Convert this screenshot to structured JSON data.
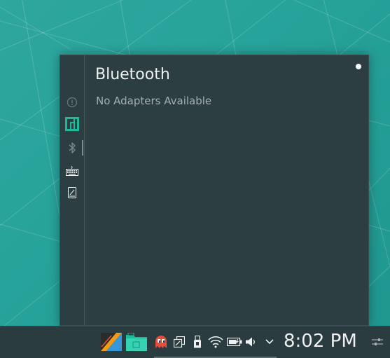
{
  "popup": {
    "title": "Bluetooth",
    "status": "No Adapters Available",
    "rail": [
      {
        "icon": "notifications-icon"
      },
      {
        "icon": "manjaro-logo-icon"
      },
      {
        "icon": "bluetooth-icon",
        "active": true
      },
      {
        "icon": "keyboard-icon"
      },
      {
        "icon": "device-notifier-icon"
      }
    ]
  },
  "panel": {
    "clock": "8:02 PM",
    "tray_icons": [
      "app-launcher-icon",
      "file-manager-icon",
      "ghost-app-icon",
      "clipboard-icon",
      "usb-device-icon",
      "wifi-icon",
      "battery-icon",
      "volume-icon",
      "expand-tray-icon"
    ]
  },
  "colors": {
    "desktop": "#27a39a",
    "popup_bg": "#2c3e41",
    "panel_bg": "#2a3c3f",
    "accent": "#1abc9c",
    "text": "#eff0f1",
    "muted_text": "#a6aeaf"
  }
}
